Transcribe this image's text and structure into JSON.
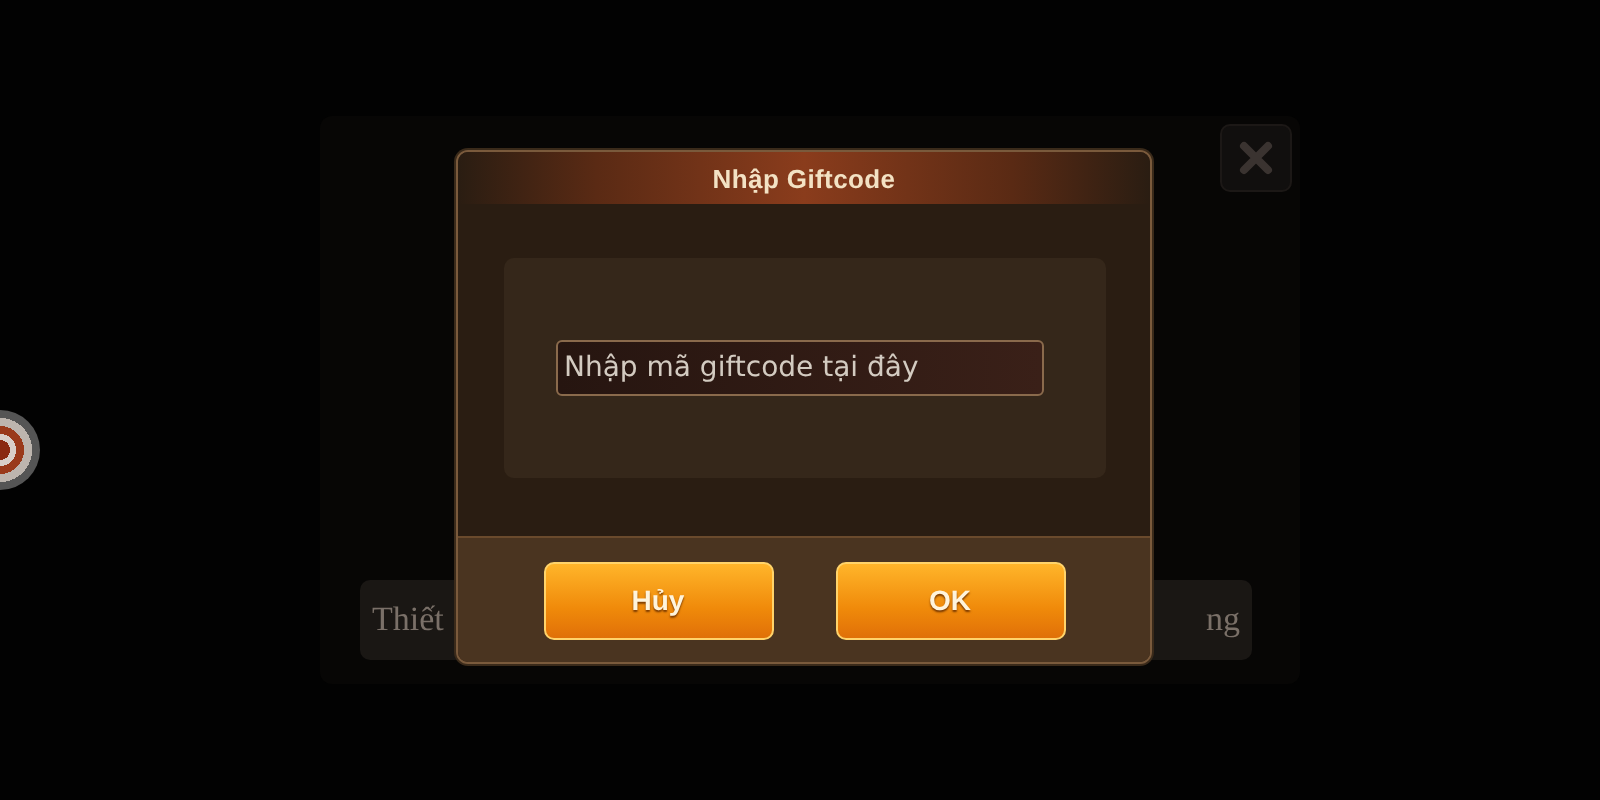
{
  "background": {
    "buttons": [
      {
        "label": "Thiết"
      },
      {
        "label": "ng"
      }
    ]
  },
  "dialog": {
    "title": "Nhập Giftcode",
    "field": {
      "placeholder": "Nhập mã giftcode tại đây"
    },
    "buttons": [
      {
        "label": "Hủy"
      },
      {
        "label": "OK"
      }
    ]
  }
}
